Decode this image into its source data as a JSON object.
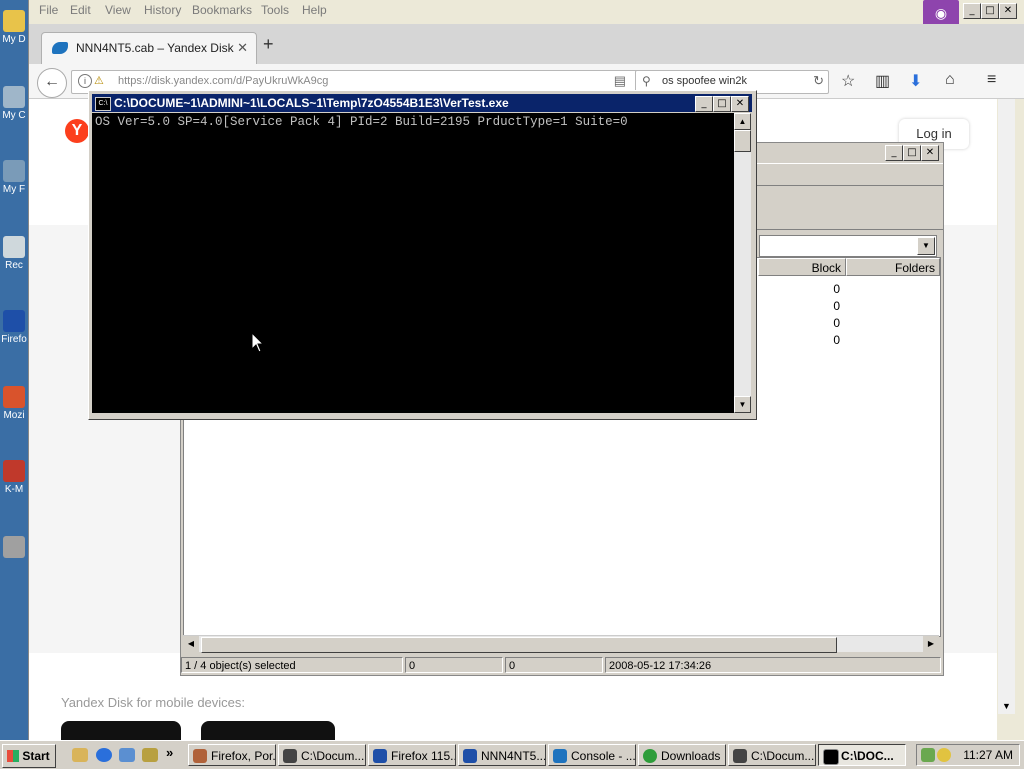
{
  "desktop": {
    "icons": [
      "My D",
      "My C",
      "My\nF",
      "Rec",
      "Firefo",
      "Mozi",
      "K-M",
      ""
    ]
  },
  "firefox": {
    "menu": [
      "File",
      "Edit",
      "View",
      "History",
      "Bookmarks",
      "Tools",
      "Help"
    ],
    "tab_title": "NNN4NT5.cab – Yandex Disk",
    "tab_close": "✕",
    "new_tab": "+",
    "url": "https://disk.yandex.com/d/PayUkruWkA9cg",
    "search_value": "os spoofee win2k",
    "page": {
      "logo": "Y",
      "login": "Log in",
      "mobile_text": "Yandex Disk for mobile devices:"
    }
  },
  "zip_window": {
    "columns": [
      "Block",
      "Folders"
    ],
    "rows": [
      {
        "folders": "0"
      },
      {
        "folders": "0"
      },
      {
        "folders": "0"
      },
      {
        "folders": "0"
      }
    ],
    "status": [
      "1 / 4 object(s) selected",
      "0",
      "0",
      "2008-05-12 17:34:26"
    ]
  },
  "console": {
    "title": "C:\\DOCUME~1\\ADMINI~1\\LOCALS~1\\Temp\\7zO4554B1E3\\VerTest.exe",
    "icon_text": "C:\\",
    "output": "OS Ver=5.0 SP=4.0[Service Pack 4] PId=2 Build=2195 PrductType=1 Suite=0"
  },
  "taskbar": {
    "start": "Start",
    "chevron": "»",
    "buttons": [
      {
        "label": "Firefox, Por...",
        "icon_color": "#b0623a"
      },
      {
        "label": "C:\\Docum...",
        "icon_color": "#444444"
      },
      {
        "label": "Firefox 115...",
        "icon_color": "#1e4fa8"
      },
      {
        "label": "NNN4NT5...",
        "icon_color": "#1e4fa8"
      },
      {
        "label": "Console - ...",
        "icon_color": "#1e73be"
      },
      {
        "label": "Downloads",
        "icon_color": "#2e9d3a"
      },
      {
        "label": "C:\\Docum...",
        "icon_color": "#444444"
      },
      {
        "label": "C:\\DOC...",
        "icon_color": "#000000"
      }
    ],
    "clock": "11:27 AM"
  }
}
